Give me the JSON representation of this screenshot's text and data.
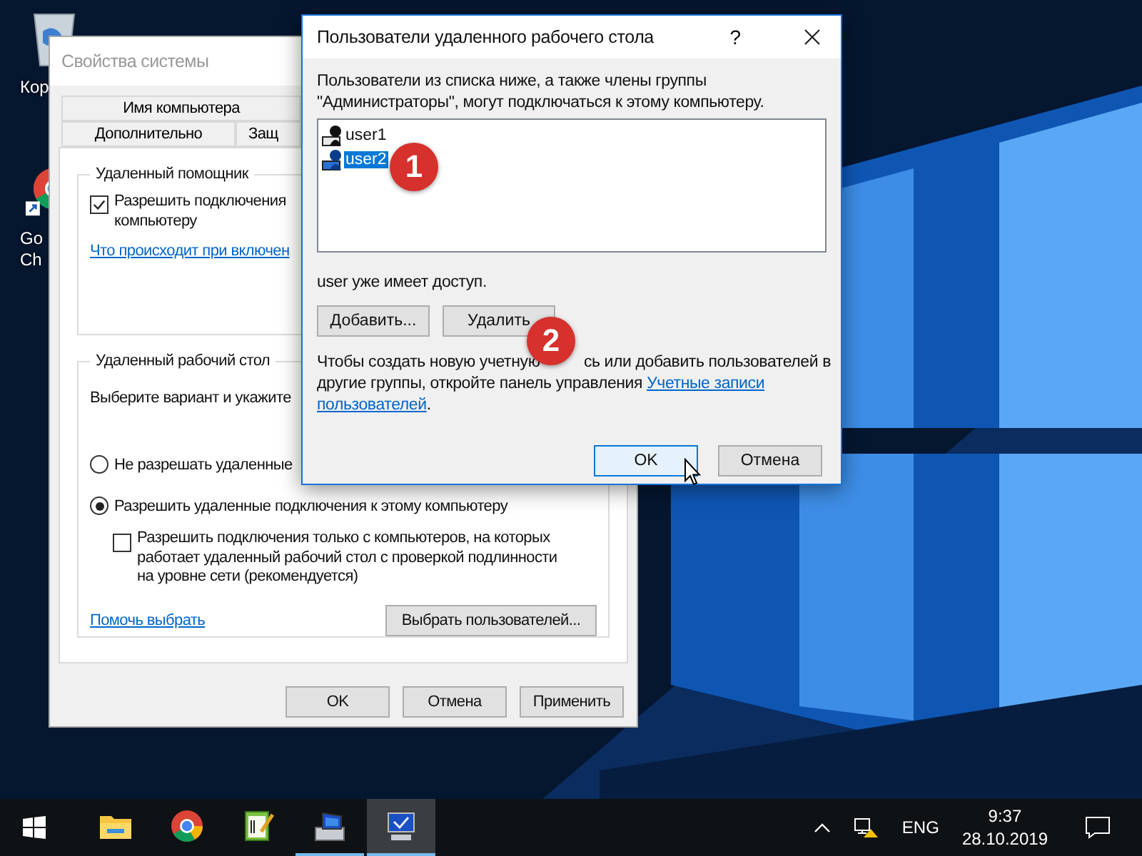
{
  "desktop": {
    "icons": [
      {
        "kind": "recycle-bin",
        "label_lines": [
          "Кор"
        ]
      },
      {
        "kind": "chrome",
        "label_lines": [
          "Go",
          "Ch"
        ]
      }
    ]
  },
  "system_properties": {
    "title": "Свойства системы",
    "tab_rows": [
      [
        {
          "label": "Имя компьютера",
          "selected": false
        }
      ],
      [
        {
          "label": "Дополнительно",
          "selected": false
        },
        {
          "label": "Защ",
          "selected": false
        }
      ]
    ],
    "remote_assistance": {
      "title": "Удаленный помощник",
      "checkbox": {
        "label_lines": [
          "Разрешить подключения",
          "компьютеру"
        ],
        "checked": true
      },
      "link": "Что происходит при включен"
    },
    "remote_desktop": {
      "title": "Удаленный рабочий стол",
      "prompt": "Выберите вариант и укажите",
      "options": [
        {
          "label": "Не разрешать удаленные",
          "selected": false
        },
        {
          "label": "Разрешить удаленные подключения к этому компьютеру",
          "selected": true
        }
      ],
      "nla": {
        "label": "Разрешить подключения только с компьютеров, на которых работает удаленный рабочий стол с проверкой подлинности на уровне сети (рекомендуется)",
        "checked": false
      },
      "help_link": "Помочь выбрать",
      "select_button": "Выбрать пользователей..."
    },
    "buttons": [
      "OK",
      "Отмена",
      "Применить"
    ]
  },
  "dialog": {
    "title": "Пользователи удаленного рабочего стола",
    "help": "?",
    "intro": "Пользователи из списка ниже, а также члены группы \"Администраторы\", могут подключаться к этому компьютеру.",
    "users": [
      {
        "name": "user1",
        "selected": false
      },
      {
        "name": "user2",
        "selected": true
      }
    ],
    "status": "user уже имеет доступ.",
    "actions": [
      "Добавить...",
      "Удалить"
    ],
    "info_first": "Чтобы создать новую учетную",
    "info_rest": "сь или добавить пользователей в",
    "info_second": "другие группы, откройте панель управления",
    "info_links": [
      "Учетные записи",
      "пользователей"
    ],
    "info_end": ".",
    "buttons": [
      {
        "label": "OK",
        "default": true
      },
      {
        "label": "Отмена",
        "default": false
      }
    ]
  },
  "annotations": [
    {
      "label": "1"
    },
    {
      "label": "2"
    }
  ],
  "taskbar": {
    "apps": [
      {
        "kind": "folder",
        "running": false,
        "selected": false
      },
      {
        "kind": "chrome",
        "running": false,
        "selected": false
      },
      {
        "kind": "editor",
        "running": false,
        "selected": false
      },
      {
        "kind": "server",
        "running": true,
        "selected": false
      },
      {
        "kind": "monitor",
        "running": true,
        "selected": true
      }
    ],
    "language": "ENG",
    "time": "9:37",
    "date": "28.10.2019"
  }
}
